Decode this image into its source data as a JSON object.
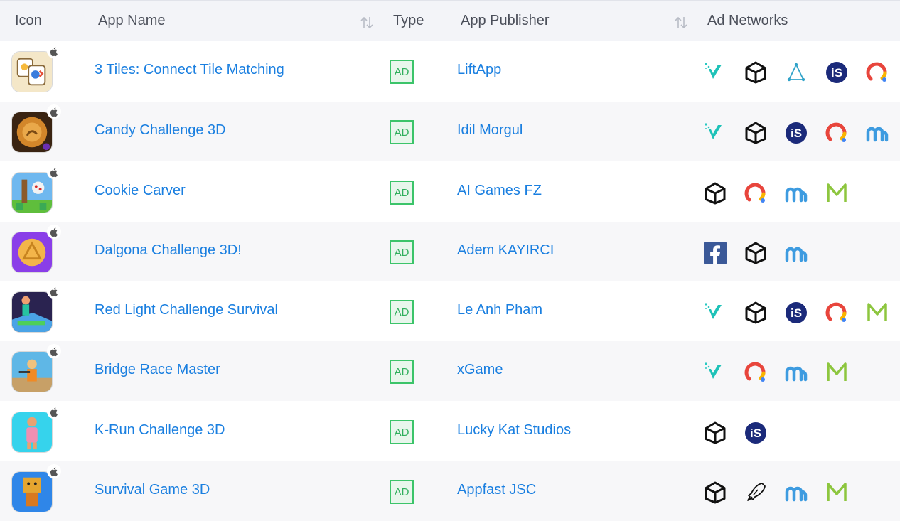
{
  "header": {
    "icon": "Icon",
    "app_name": "App Name",
    "type": "Type",
    "app_publisher": "App Publisher",
    "ad_networks": "Ad Networks"
  },
  "colors": {
    "link": "#1a7fe0",
    "badge_green": "#3cc46a",
    "header_bg": "#f3f4f8"
  },
  "rows": [
    {
      "name": "3 Tiles: Connect Tile Matching",
      "type": "AD",
      "publisher": "LiftApp",
      "icon": "tiles-app-icon",
      "platform": "apple-icon",
      "networks": [
        "vungle-icon",
        "unity-icon",
        "applovin-icon",
        "ironsource-icon",
        "google-admob-icon"
      ]
    },
    {
      "name": "Candy Challenge 3D",
      "type": "AD",
      "publisher": "Idil Morgul",
      "icon": "candy-app-icon",
      "platform": "apple-icon",
      "networks": [
        "vungle-icon",
        "unity-icon",
        "ironsource-icon",
        "google-admob-icon",
        "mintegral-icon"
      ]
    },
    {
      "name": "Cookie Carver",
      "type": "AD",
      "publisher": "AI Games FZ",
      "icon": "cookie-app-icon",
      "platform": "apple-icon",
      "networks": [
        "unity-icon",
        "google-admob-icon",
        "mintegral-icon",
        "maio-icon"
      ]
    },
    {
      "name": "Dalgona Challenge 3D!",
      "type": "AD",
      "publisher": "Adem KAYIRCI",
      "icon": "dalgona-app-icon",
      "platform": "apple-icon",
      "networks": [
        "facebook-icon",
        "unity-icon",
        "mintegral-icon"
      ]
    },
    {
      "name": "Red Light Challenge Survival",
      "type": "AD",
      "publisher": "Le Anh Pham",
      "icon": "redlight-app-icon",
      "platform": "apple-icon",
      "networks": [
        "vungle-icon",
        "unity-icon",
        "ironsource-icon",
        "google-admob-icon",
        "maio-icon"
      ]
    },
    {
      "name": "Bridge Race Master",
      "type": "AD",
      "publisher": "xGame",
      "icon": "bridge-app-icon",
      "platform": "apple-icon",
      "networks": [
        "vungle-icon",
        "google-admob-icon",
        "mintegral-icon",
        "maio-icon"
      ]
    },
    {
      "name": "K-Run Challenge 3D",
      "type": "AD",
      "publisher": "Lucky Kat Studios",
      "icon": "krun-app-icon",
      "platform": "apple-icon",
      "networks": [
        "unity-icon",
        "ironsource-icon"
      ]
    },
    {
      "name": "Survival Game 3D",
      "type": "AD",
      "publisher": "Appfast JSC",
      "icon": "survival-app-icon",
      "platform": "apple-icon",
      "networks": [
        "unity-icon",
        "chartboost-icon",
        "mintegral-icon",
        "maio-icon"
      ]
    }
  ]
}
